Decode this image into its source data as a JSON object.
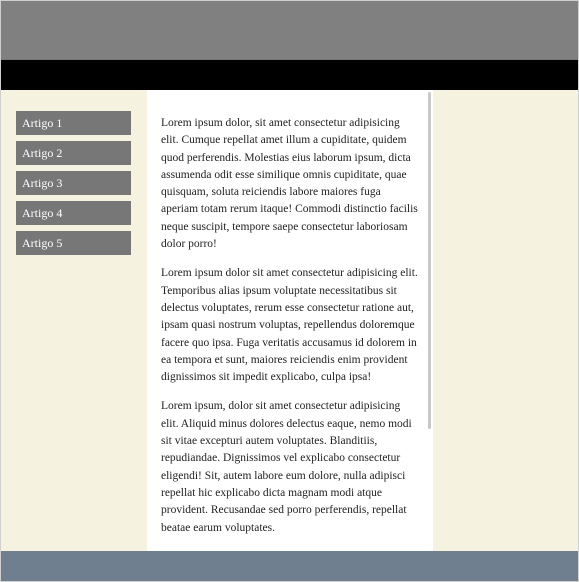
{
  "sidebar": {
    "items": [
      {
        "label": "Artigo 1"
      },
      {
        "label": "Artigo 2"
      },
      {
        "label": "Artigo 3"
      },
      {
        "label": "Artigo 4"
      },
      {
        "label": "Artigo 5"
      }
    ]
  },
  "main": {
    "paragraphs": [
      "Lorem ipsum dolor, sit amet consectetur adipisicing elit. Cumque repellat amet illum a cupiditate, quidem quod perferendis. Molestias eius laborum ipsum, dicta assumenda odit esse similique omnis cupiditate, quae quisquam, soluta reiciendis labore maiores fuga aperiam totam rerum itaque! Commodi distinctio facilis neque suscipit, tempore saepe consectetur laboriosam dolor porro!",
      "Lorem ipsum dolor sit amet consectetur adipisicing elit. Temporibus alias ipsum voluptate necessitatibus sit delectus voluptates, rerum esse consectetur ratione aut, ipsam quasi nostrum voluptas, repellendus doloremque facere quo ipsa. Fuga veritatis accusamus id dolorem in ea tempora et sunt, maiores reiciendis enim provident dignissimos sit impedit explicabo, culpa ipsa!",
      "Lorem ipsum, dolor sit amet consectetur adipisicing elit. Aliquid minus dolores delectus eaque, nemo modi sit vitae excepturi autem voluptates. Blanditiis, repudiandae. Dignissimos vel explicabo consectetur eligendi! Sit, autem labore eum dolore, nulla adipisci repellat hic explicabo dicta magnam modi atque provident. Recusandae sed porro perferendis, repellat beatae earum voluptates."
    ]
  },
  "colors": {
    "header": "#808080",
    "nav_bar": "#000000",
    "content_background": "#f5f3df",
    "sidebar_item": "#777777",
    "footer": "#6f7f8f"
  }
}
